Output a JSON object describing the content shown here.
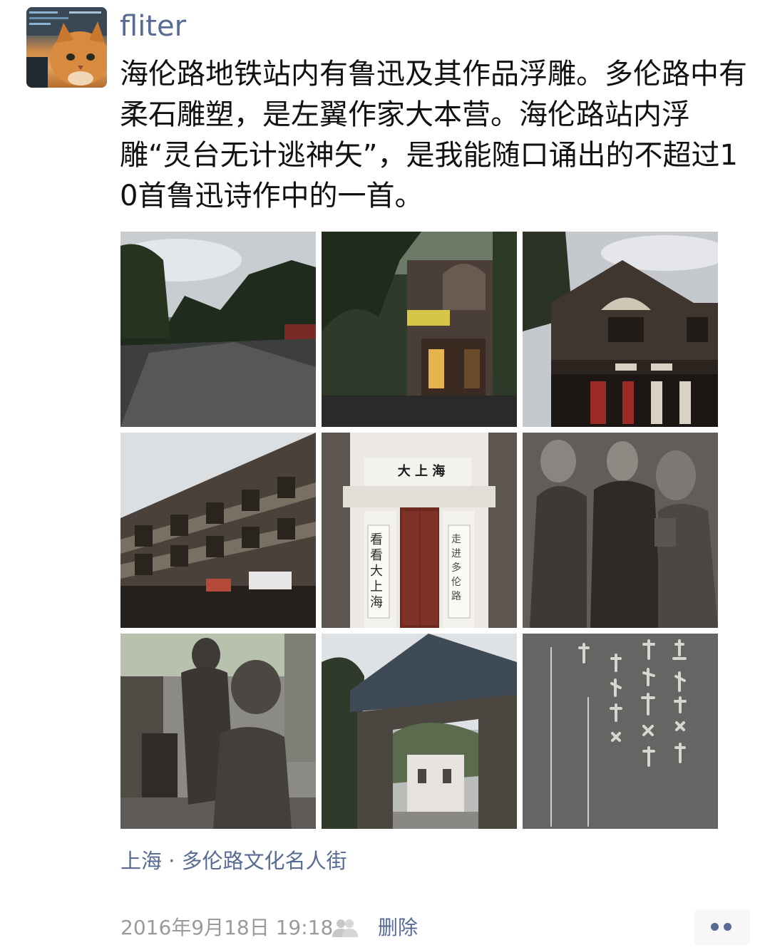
{
  "post": {
    "author": "fliter",
    "text": "海伦路地铁站内有鲁迅及其作品浮雕。多伦路中有柔石雕塑，是左翼作家大本营。海伦路站内浮雕“灵台无计逃神矢”，是我能随口诵出的不超过10首鲁迅诗作中的一首。",
    "location": "上海 · 多伦路文化名人街",
    "timestamp": "2016年9月18日 19:18",
    "delete_label": "删除",
    "privacy_icon": "friends-visibility-icon",
    "more_icon": "more-dots-icon"
  },
  "photos": [
    {
      "signboard": ""
    },
    {
      "signboard": ""
    },
    {
      "signboard": ""
    },
    {
      "signboard": ""
    },
    {
      "signboard": "大 上 海",
      "couplet_left": "看看大上海",
      "couplet_right": "走进多伦路"
    },
    {
      "signboard": ""
    },
    {
      "signboard": ""
    },
    {
      "signboard": ""
    },
    {
      "signboard": ""
    }
  ],
  "colors": {
    "link": "#576b95",
    "text": "#111111",
    "meta": "#9a9a9a"
  }
}
